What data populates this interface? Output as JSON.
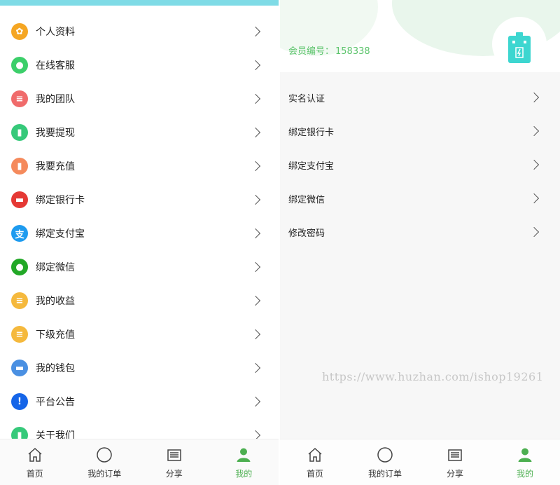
{
  "left": {
    "menu": [
      {
        "label": "个人资料",
        "icon": "gear-icon",
        "color": "#f5a623",
        "glyph": "✿"
      },
      {
        "label": "在线客服",
        "icon": "chat-icon",
        "color": "#3ccf6a",
        "glyph": "●"
      },
      {
        "label": "我的团队",
        "icon": "list-icon",
        "color": "#f06b6b",
        "glyph": "≡"
      },
      {
        "label": "我要提现",
        "icon": "wallet-icon",
        "color": "#36c97a",
        "glyph": "▮"
      },
      {
        "label": "我要充值",
        "icon": "recharge-icon",
        "color": "#f58a5c",
        "glyph": "▮"
      },
      {
        "label": "绑定银行卡",
        "icon": "bank-card-icon",
        "color": "#e53935",
        "glyph": "▬"
      },
      {
        "label": "绑定支付宝",
        "icon": "alipay-icon",
        "color": "#1e9bef",
        "glyph": "支"
      },
      {
        "label": "绑定微信",
        "icon": "wechat-icon",
        "color": "#22a827",
        "glyph": "●"
      },
      {
        "label": "我的收益",
        "icon": "earnings-icon",
        "color": "#f5b93d",
        "glyph": "≡"
      },
      {
        "label": "下级充值",
        "icon": "sub-recharge-icon",
        "color": "#f5b93d",
        "glyph": "≡"
      },
      {
        "label": "我的钱包",
        "icon": "purse-icon",
        "color": "#4a90e2",
        "glyph": "▬"
      },
      {
        "label": "平台公告",
        "icon": "notice-icon",
        "color": "#1565e8",
        "glyph": "!"
      },
      {
        "label": "关于我们",
        "icon": "about-icon",
        "color": "#36c97a",
        "glyph": "▮"
      }
    ],
    "tabs": [
      {
        "label": "首页",
        "icon": "home-icon"
      },
      {
        "label": "我的订单",
        "icon": "order-icon"
      },
      {
        "label": "分享",
        "icon": "share-icon"
      },
      {
        "label": "我的",
        "icon": "user-icon"
      }
    ]
  },
  "right": {
    "member_label": "会员编号：",
    "member_id": "158338",
    "menu": [
      "实名认证",
      "绑定银行卡",
      "绑定支付宝",
      "绑定微信",
      "修改密码"
    ],
    "watermark": "https://www.huzhan.com/ishop19261",
    "tabs": [
      {
        "label": "首页",
        "icon": "home-icon"
      },
      {
        "label": "我的订单",
        "icon": "order-icon"
      },
      {
        "label": "分享",
        "icon": "share-icon"
      },
      {
        "label": "我的",
        "icon": "user-icon"
      }
    ]
  },
  "colors": {
    "accent": "#4caf50",
    "topbar": "#7fdbe6",
    "member": "#5cc46c",
    "battery": "#3dd6d0"
  }
}
